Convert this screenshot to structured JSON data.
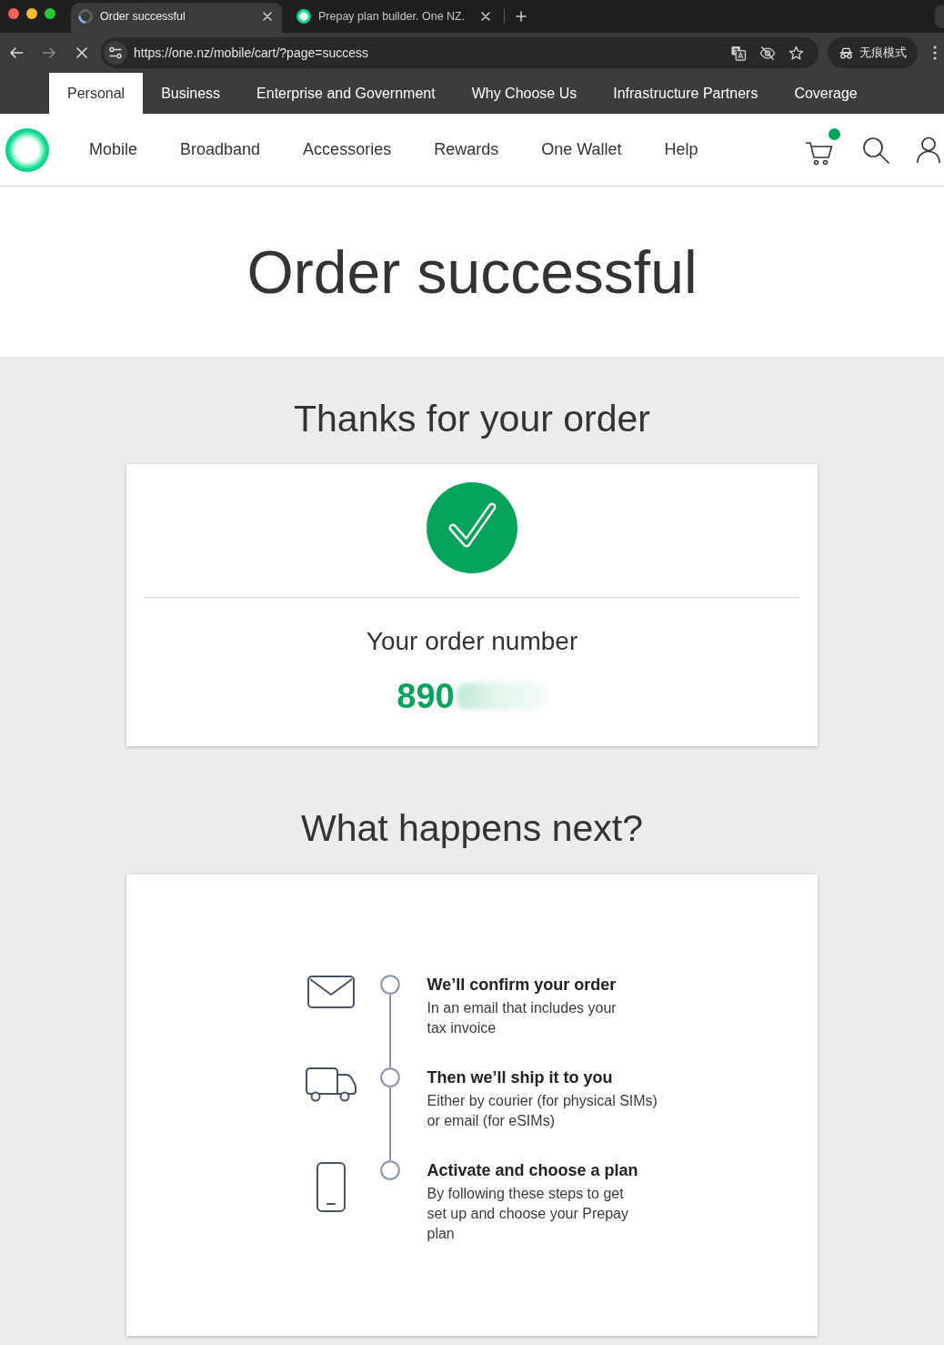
{
  "browser": {
    "tabs": [
      {
        "title": "Order successful",
        "loading": true,
        "selected": true
      },
      {
        "title": "Prepay plan builder. One NZ.",
        "loading": false,
        "selected": false
      }
    ],
    "nav_buttons": [
      {
        "kind": "back",
        "disabled": false
      },
      {
        "kind": "forward",
        "disabled": true
      },
      {
        "kind": "stop",
        "disabled": false
      }
    ],
    "url": "https://one.nz/mobile/cart/?page=success",
    "profile_label": "无痕模式"
  },
  "segment_nav": [
    {
      "label": "Personal",
      "selected": true
    },
    {
      "label": "Business",
      "selected": false
    },
    {
      "label": "Enterprise and Government",
      "selected": false
    },
    {
      "label": "Why Choose Us",
      "selected": false
    },
    {
      "label": "Infrastructure Partners",
      "selected": false
    },
    {
      "label": "Coverage",
      "selected": false
    }
  ],
  "main_nav": {
    "items": [
      "Mobile",
      "Broadband",
      "Accessories",
      "Rewards",
      "One Wallet",
      "Help"
    ],
    "cart_badge": true
  },
  "hero": {
    "title": "Order successful"
  },
  "confirmation": {
    "heading": "Thanks for your order",
    "order_number_label": "Your order number",
    "order_number": "890"
  },
  "next_steps": {
    "heading": "What happens next?",
    "steps": [
      {
        "kind": "email",
        "title": "We’ll confirm your order",
        "description": "In an email that includes your\ntax invoice"
      },
      {
        "kind": "delivery",
        "title": "Then we’ll ship it to you",
        "description": "Either by courier (for physical SIMs)\nor email (for eSIMs)"
      },
      {
        "kind": "phone",
        "title": "Activate and choose a plan",
        "description": "By following these steps to get\nset up and choose your Prepay\nplan"
      }
    ]
  }
}
